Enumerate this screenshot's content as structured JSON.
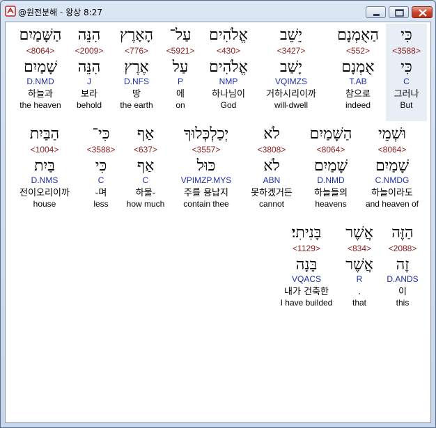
{
  "window": {
    "title": "@원전분해 - 왕상 8:27"
  },
  "rows": [
    [
      {
        "heb": "כִּי",
        "strong": "<3588>",
        "lemma": "כִּי",
        "morph": "C",
        "kor": "그러나",
        "eng": "But"
      },
      {
        "heb": "הַאֻמְנָם",
        "strong": "<552>",
        "lemma": "אֻמְנָם",
        "morph": "T.AB",
        "kor": "참으로",
        "eng": "indeed"
      },
      {
        "heb": "יֵשֵׁב",
        "strong": "<3427>",
        "lemma": "יָשַׁב",
        "morph": "VQIMZS",
        "kor": "거하시리이까",
        "eng": "will-dwell"
      },
      {
        "heb": "אֱלֹהִים",
        "strong": "<430>",
        "lemma": "אֱלֹהִים",
        "morph": "NMP",
        "kor": "하나님이",
        "eng": "God"
      },
      {
        "heb": "עַל־",
        "strong": "<5921>",
        "lemma": "עַל",
        "morph": "P",
        "kor": "에",
        "eng": "on"
      },
      {
        "heb": "הָאָרֶץ",
        "strong": "<776>",
        "lemma": "אֶרֶץ",
        "morph": "D.NFS",
        "kor": "땅",
        "eng": "the earth"
      },
      {
        "heb": "הִנֵּה",
        "strong": "<2009>",
        "lemma": "הִנֵּה",
        "morph": "J",
        "kor": "보라",
        "eng": "behold"
      },
      {
        "heb": "הַשָּׁמַיִם",
        "strong": "<8064>",
        "lemma": "שָׁמַיִם",
        "morph": "D.NMD",
        "kor": "하늘과",
        "eng": "the heaven"
      }
    ],
    [
      {
        "heb": "וּשְׁמֵי",
        "strong": "<8064>",
        "lemma": "שָׁמַיִם",
        "morph": "C.NMDG",
        "kor": "하늘이라도",
        "eng": "and heaven of"
      },
      {
        "heb": "הַשָּׁמַיִם",
        "strong": "<8064>",
        "lemma": "שָׁמַיִם",
        "morph": "D.NMD",
        "kor": "하늘들의",
        "eng": "heavens"
      },
      {
        "heb": "לֹא",
        "strong": "<3808>",
        "lemma": "לֹא",
        "morph": "ABN",
        "kor": "못하겠거든",
        "eng": "cannot"
      },
      {
        "heb": "יְכַלְכְּלוּךָ",
        "strong": "<3557>",
        "lemma": "כּוּל",
        "morph": "VPIMZP.MYS",
        "kor": "주를 용납지",
        "eng": "contain thee"
      },
      {
        "heb": "אַף",
        "strong": "<637>",
        "lemma": "אַף",
        "morph": "C",
        "kor": "하물-",
        "eng": "how much"
      },
      {
        "heb": "כִּי־",
        "strong": "<3588>",
        "lemma": "כִּי",
        "morph": "C",
        "kor": "-며",
        "eng": "less"
      },
      {
        "heb": "הַבַּיִת",
        "strong": "<1004>",
        "lemma": "בַּיִת",
        "morph": "D.NMS",
        "kor": "전이오리이까",
        "eng": "house"
      }
    ],
    [
      {
        "heb": "הַזֶּה",
        "strong": "<2088>",
        "lemma": "זֶה",
        "morph": "D.ANDS",
        "kor": "이",
        "eng": "this"
      },
      {
        "heb": "אֲשֶׁר",
        "strong": "<834>",
        "lemma": "אֲשֶׁר",
        "morph": "R",
        "kor": ".",
        "eng": "that"
      },
      {
        "heb": "בָּנִיתִי׃",
        "strong": "<1129>",
        "lemma": "בָּנָה",
        "morph": "VQACS",
        "kor": "내가 건축한",
        "eng": "I have builded"
      }
    ]
  ]
}
